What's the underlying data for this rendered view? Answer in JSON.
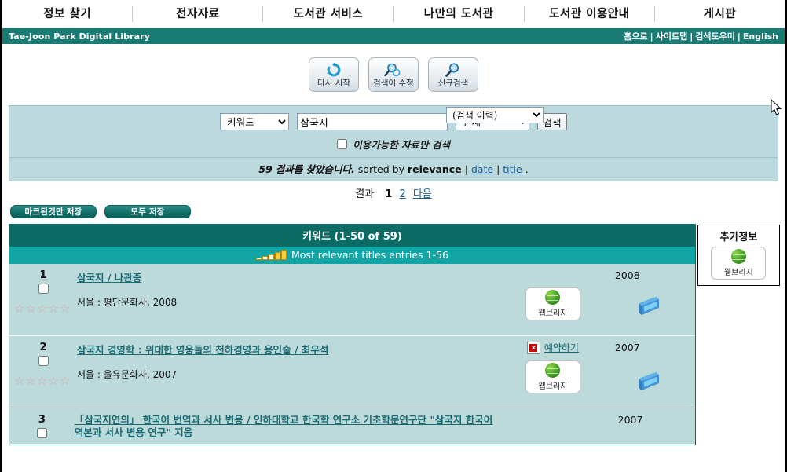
{
  "topnav": {
    "items": [
      {
        "label": "정보 찾기"
      },
      {
        "label": "전자자료"
      },
      {
        "label": "도서관 서비스"
      },
      {
        "label": "나만의 도서관"
      },
      {
        "label": "도서관 이용안내"
      },
      {
        "label": "게시판"
      }
    ]
  },
  "brandbar": {
    "title": "Tae-Joon Park Digital Library",
    "links": [
      "홈으로",
      "사이트맵",
      "검색도우미",
      "English"
    ],
    "separator": "|",
    "bg_color": "#1a7b75"
  },
  "toolbar": {
    "buttons": [
      {
        "label": "다시 시작",
        "icon": "refresh-icon"
      },
      {
        "label": "검색어 수정",
        "icon": "edit-search-icon"
      },
      {
        "label": "신규검색",
        "icon": "magnifier-icon"
      }
    ],
    "history_select": {
      "value": "(검색 이력)",
      "options": [
        "(검색 이력)"
      ]
    }
  },
  "search": {
    "field_select": {
      "value": "키워드",
      "options": [
        "키워드"
      ]
    },
    "query": {
      "value": "삼국지",
      "placeholder": ""
    },
    "scope_select": {
      "value": "전체",
      "options": [
        "전체"
      ]
    },
    "submit_label": "검색",
    "limit_checkbox": {
      "label": "이용가능한 자료만 검색",
      "checked": false
    },
    "bg_color": "#bcdade"
  },
  "results_summary": {
    "count": "59",
    "found_text": "결과를 찾았습니다.",
    "sorted_by_label": "sorted by",
    "current_sort": "relevance",
    "sort_links": [
      "date",
      "title"
    ],
    "trailing": "."
  },
  "pager": {
    "label": "결과",
    "current": "1",
    "pages": [
      "2"
    ],
    "next_label": "다음"
  },
  "save_buttons": [
    {
      "label": "마크된것만 저장"
    },
    {
      "label": "모두 저장"
    }
  ],
  "results_header": {
    "title": "키워드 (1-50 of 59)",
    "subtitle": "Most relevant titles entries 1-56",
    "header_bg": "#0d6b66",
    "sub_bg": "#11a5a5"
  },
  "rows": [
    {
      "num": "1",
      "title": "삼국지 / 나관중",
      "imprint": "서울 : 평단문화사, 2008",
      "year": "2008",
      "stars": 5,
      "hold": null,
      "webbridge_label": "웹브리지",
      "has_book_icon": true
    },
    {
      "num": "2",
      "title": "삼국지 경영학 : 위대한 영웅들의 천하경영과 용인술 / 최우석",
      "imprint": "서울 : 을유문화사, 2007",
      "year": "2007",
      "stars": 5,
      "hold": "예약하기",
      "webbridge_label": "웹브리지",
      "has_book_icon": true
    },
    {
      "num": "3",
      "title": "「삼국지연의」 한국어 번역과 서사 변용 / 인하대학교 한국학 연구소 기초학문연구단 \"삼국지 한국어역본과 서사 변용 연구\" 지음",
      "imprint": "",
      "year": "2007",
      "stars": 0,
      "hold": null,
      "webbridge_label": "",
      "has_book_icon": false
    }
  ],
  "sidebar": {
    "card_title": "추가정보",
    "webbridge_label": "웹브리지"
  }
}
